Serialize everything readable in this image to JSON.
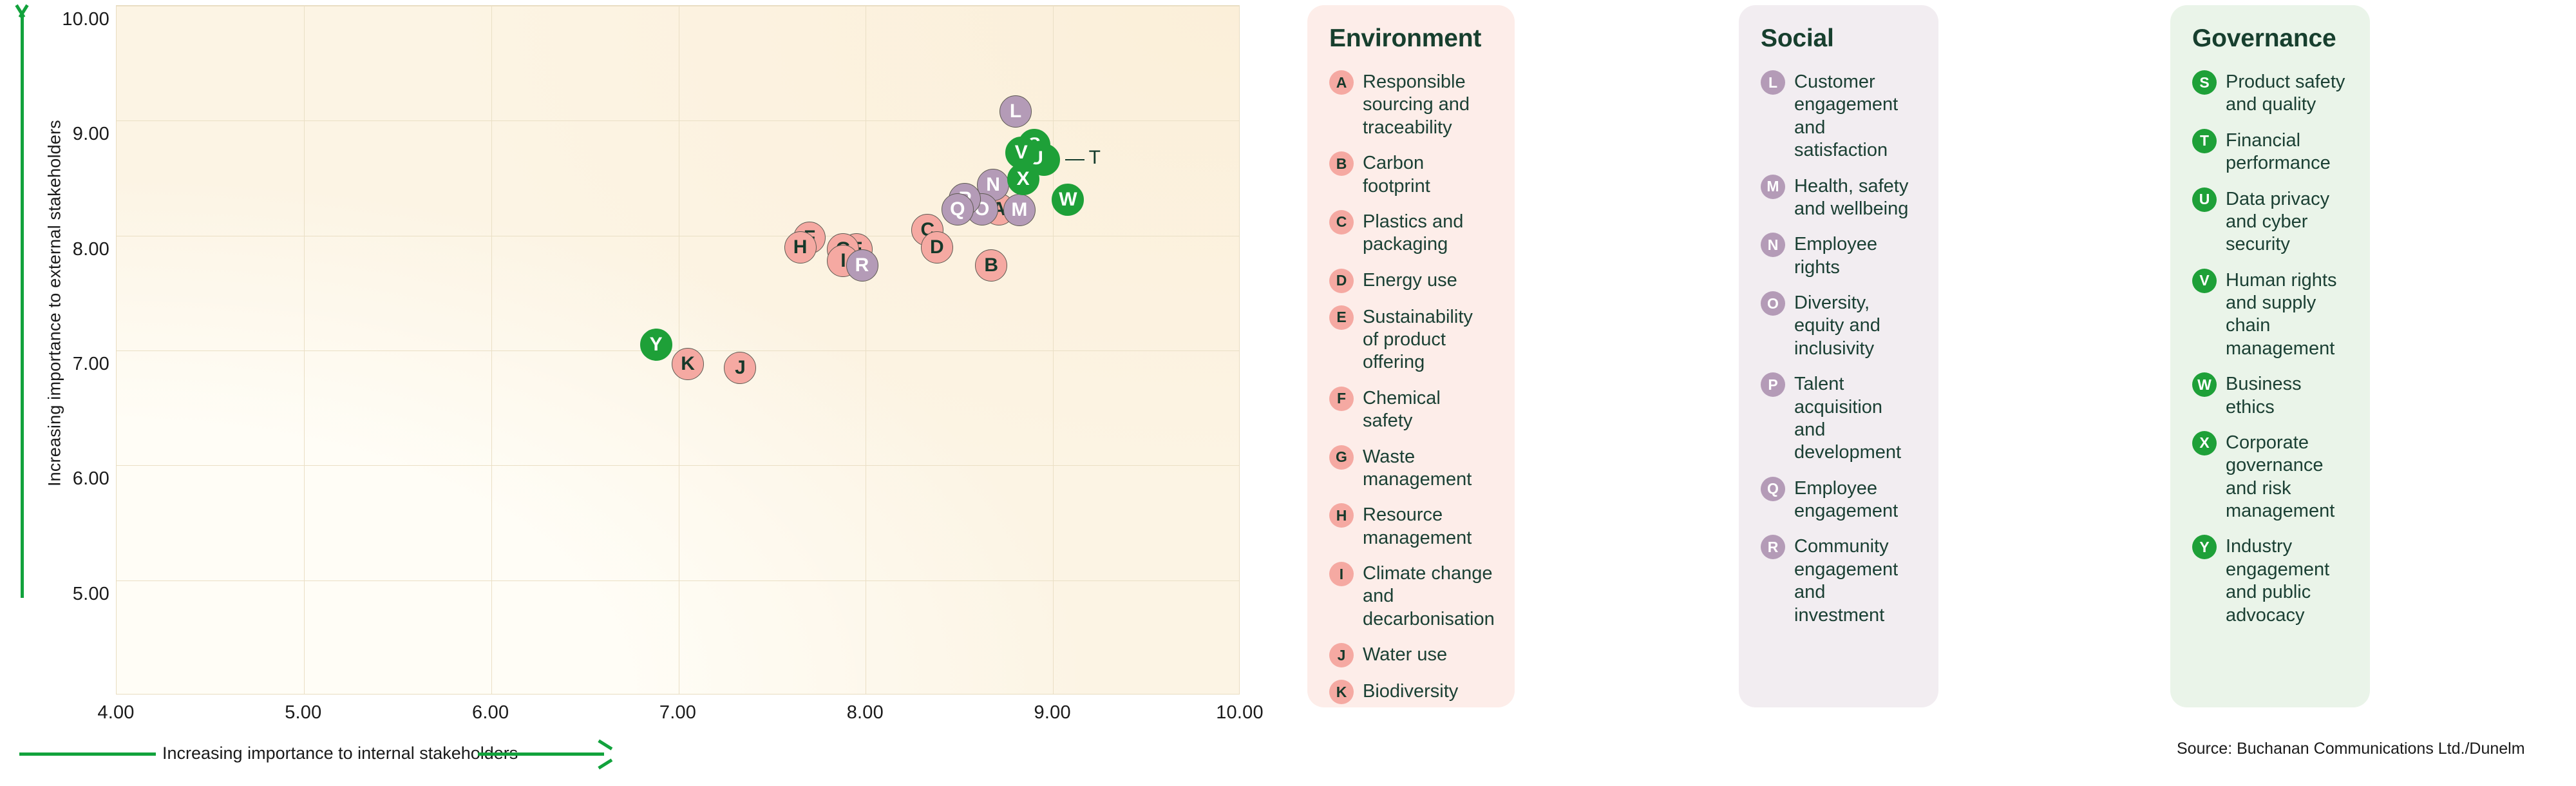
{
  "chart_data": {
    "type": "scatter",
    "title": "",
    "xlabel": "Increasing importance to internal stakeholders",
    "ylabel": "Increasing importance to external stakeholders",
    "xlim": [
      4.0,
      10.0
    ],
    "ylim": [
      4.0,
      10.0
    ],
    "xticks": [
      "4.00",
      "5.00",
      "6.00",
      "7.00",
      "8.00",
      "9.00",
      "10.00"
    ],
    "yticks": [
      "10.00",
      "9.00",
      "8.00",
      "7.00",
      "6.00",
      "5.00"
    ],
    "grid": true,
    "legend_position": "right-panels",
    "points": [
      {
        "code": "A",
        "label": "Responsible sourcing and traceability",
        "group": "Environment",
        "x": 8.71,
        "y": 8.23
      },
      {
        "code": "B",
        "label": "Carbon footprint",
        "group": "Environment",
        "x": 8.67,
        "y": 7.74
      },
      {
        "code": "C",
        "label": "Plastics and packaging",
        "group": "Environment",
        "x": 8.33,
        "y": 8.05
      },
      {
        "code": "D",
        "label": "Energy use",
        "group": "Environment",
        "x": 8.38,
        "y": 7.9
      },
      {
        "code": "E",
        "label": "Sustainability of product offering",
        "group": "Environment",
        "x": 7.95,
        "y": 7.88
      },
      {
        "code": "F",
        "label": "Chemical safety",
        "group": "Environment",
        "x": 7.7,
        "y": 7.98
      },
      {
        "code": "G",
        "label": "Waste management",
        "group": "Environment",
        "x": 7.88,
        "y": 7.88
      },
      {
        "code": "H",
        "label": "Resource management",
        "group": "Environment",
        "x": 7.65,
        "y": 7.9
      },
      {
        "code": "I",
        "label": "Climate change and decarbonisation",
        "group": "Environment",
        "x": 7.88,
        "y": 7.78
      },
      {
        "code": "J",
        "label": "Water use",
        "group": "Environment",
        "x": 7.33,
        "y": 6.85
      },
      {
        "code": "K",
        "label": "Biodiversity",
        "group": "Environment",
        "x": 7.05,
        "y": 6.88
      },
      {
        "code": "L",
        "label": "Customer engagement and satisfaction",
        "group": "Social",
        "x": 8.8,
        "y": 9.08
      },
      {
        "code": "M",
        "label": "Health, safety and wellbeing",
        "group": "Social",
        "x": 8.82,
        "y": 8.22
      },
      {
        "code": "N",
        "label": "Employee rights",
        "group": "Social",
        "x": 8.68,
        "y": 8.44
      },
      {
        "code": "O",
        "label": "Diversity, equity and inclusivity",
        "group": "Social",
        "x": 8.62,
        "y": 8.23
      },
      {
        "code": "P",
        "label": "Talent acquisition and development",
        "group": "Social",
        "x": 8.53,
        "y": 8.32
      },
      {
        "code": "Q",
        "label": "Employee engagement",
        "group": "Social",
        "x": 8.49,
        "y": 8.23
      },
      {
        "code": "R",
        "label": "Community engagement and investment",
        "group": "Social",
        "x": 7.98,
        "y": 7.74
      },
      {
        "code": "S",
        "label": "Product safety and quality",
        "group": "Governance",
        "x": 8.9,
        "y": 8.79
      },
      {
        "code": "T",
        "label": "Financial performance",
        "group": "Governance",
        "x": 8.95,
        "y": 8.66,
        "callout": true
      },
      {
        "code": "U",
        "label": "Data privacy and cyber security",
        "group": "Governance",
        "x": 8.91,
        "y": 8.67
      },
      {
        "code": "V",
        "label": "Human rights and supply chain management",
        "group": "Governance",
        "x": 8.83,
        "y": 8.72
      },
      {
        "code": "W",
        "label": "Business ethics",
        "group": "Governance",
        "x": 9.08,
        "y": 8.31
      },
      {
        "code": "X",
        "label": "Corporate governance and risk management",
        "group": "Governance",
        "x": 8.84,
        "y": 8.49
      },
      {
        "code": "Y",
        "label": "Industry engagement and public advocacy",
        "group": "Governance",
        "x": 6.88,
        "y": 7.05
      }
    ],
    "colors": {
      "Environment": "#F5A9A2",
      "Social": "#B49BB7",
      "Governance": "#1EA038",
      "plot_background": "#FCF4E4",
      "gridline": "#EADFC5",
      "axis_arrow": "#12A23C",
      "text": "#16382A"
    }
  },
  "axes": {
    "x_title": "Increasing importance to internal stakeholders",
    "y_title": "Increasing importance to external stakeholders",
    "x_ticks": [
      "4.00",
      "5.00",
      "6.00",
      "7.00",
      "8.00",
      "9.00",
      "10.00"
    ],
    "y_ticks": [
      "10.00",
      "9.00",
      "8.00",
      "7.00",
      "6.00",
      "5.00"
    ]
  },
  "callout": {
    "code": "T"
  },
  "legend": {
    "environment": {
      "title": "Environment",
      "items": [
        {
          "code": "A",
          "label": "Responsible sourcing and traceability"
        },
        {
          "code": "B",
          "label": "Carbon footprint"
        },
        {
          "code": "C",
          "label": "Plastics and packaging"
        },
        {
          "code": "D",
          "label": "Energy use"
        },
        {
          "code": "E",
          "label": "Sustainability of product offering"
        },
        {
          "code": "F",
          "label": "Chemical safety"
        },
        {
          "code": "G",
          "label": "Waste management"
        },
        {
          "code": "H",
          "label": "Resource management"
        },
        {
          "code": "I",
          "label": "Climate change and decarbonisation"
        },
        {
          "code": "J",
          "label": "Water use"
        },
        {
          "code": "K",
          "label": "Biodiversity"
        }
      ]
    },
    "social": {
      "title": "Social",
      "items": [
        {
          "code": "L",
          "label": "Customer engagement and satisfaction"
        },
        {
          "code": "M",
          "label": "Health, safety and wellbeing"
        },
        {
          "code": "N",
          "label": "Employee rights"
        },
        {
          "code": "O",
          "label": "Diversity, equity and inclusivity"
        },
        {
          "code": "P",
          "label": "Talent acquisition and development"
        },
        {
          "code": "Q",
          "label": "Employee engagement"
        },
        {
          "code": "R",
          "label": "Community engagement and investment"
        }
      ]
    },
    "governance": {
      "title": "Governance",
      "items": [
        {
          "code": "S",
          "label": "Product safety and quality"
        },
        {
          "code": "T",
          "label": "Financial performance"
        },
        {
          "code": "U",
          "label": "Data privacy and cyber security"
        },
        {
          "code": "V",
          "label": "Human rights and supply chain management"
        },
        {
          "code": "W",
          "label": "Business ethics"
        },
        {
          "code": "X",
          "label": "Corporate governance and risk management"
        },
        {
          "code": "Y",
          "label": "Industry engagement and public advocacy"
        }
      ]
    }
  },
  "source": "Source: Buchanan Communications Ltd./Dunelm"
}
